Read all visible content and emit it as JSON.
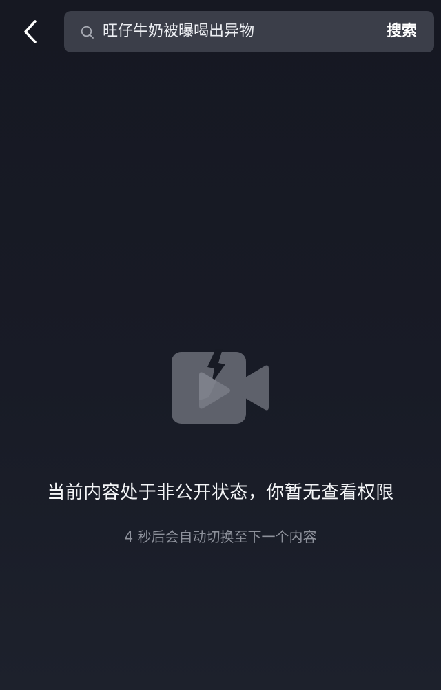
{
  "search": {
    "query": "旺仔牛奶被曝喝出异物",
    "button_label": "搜索"
  },
  "icons": {
    "back": "chevron-left-icon",
    "search": "magnifier-icon",
    "placeholder": "broken-video-camera-icon"
  },
  "status": {
    "message": "当前内容处于非公开状态，你暂无查看权限",
    "countdown_text": "4 秒后会自动切换至下一个内容"
  },
  "colors": {
    "background": "#161822",
    "search_box": "#3b3e49",
    "icon_gray": "#5e616b",
    "subtext": "#8d919b"
  }
}
